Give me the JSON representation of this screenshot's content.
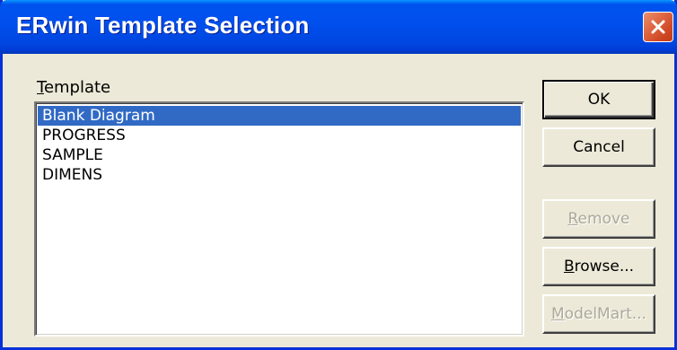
{
  "window": {
    "title": "ERwin Template Selection",
    "accent_color": "#0054e3",
    "close_button_color": "#e16b47"
  },
  "template_label": {
    "mnemonic": "T",
    "rest": "emplate"
  },
  "template_list": {
    "items": [
      {
        "label": "Blank Diagram",
        "selected": true
      },
      {
        "label": "PROGRESS",
        "selected": false
      },
      {
        "label": "SAMPLE",
        "selected": false
      },
      {
        "label": "DIMENS",
        "selected": false
      }
    ],
    "selection_color": "#316ac5"
  },
  "buttons": {
    "ok": {
      "label": "OK",
      "enabled": true,
      "default": true
    },
    "cancel": {
      "label": "Cancel",
      "enabled": true
    },
    "remove": {
      "mnemonic": "R",
      "rest": "emove",
      "enabled": false
    },
    "browse": {
      "mnemonic": "B",
      "rest": "rowse...",
      "enabled": true
    },
    "modelmart": {
      "mnemonic": "M",
      "rest": "odelMart...",
      "enabled": false
    }
  },
  "icons": {
    "close": "close-icon"
  }
}
